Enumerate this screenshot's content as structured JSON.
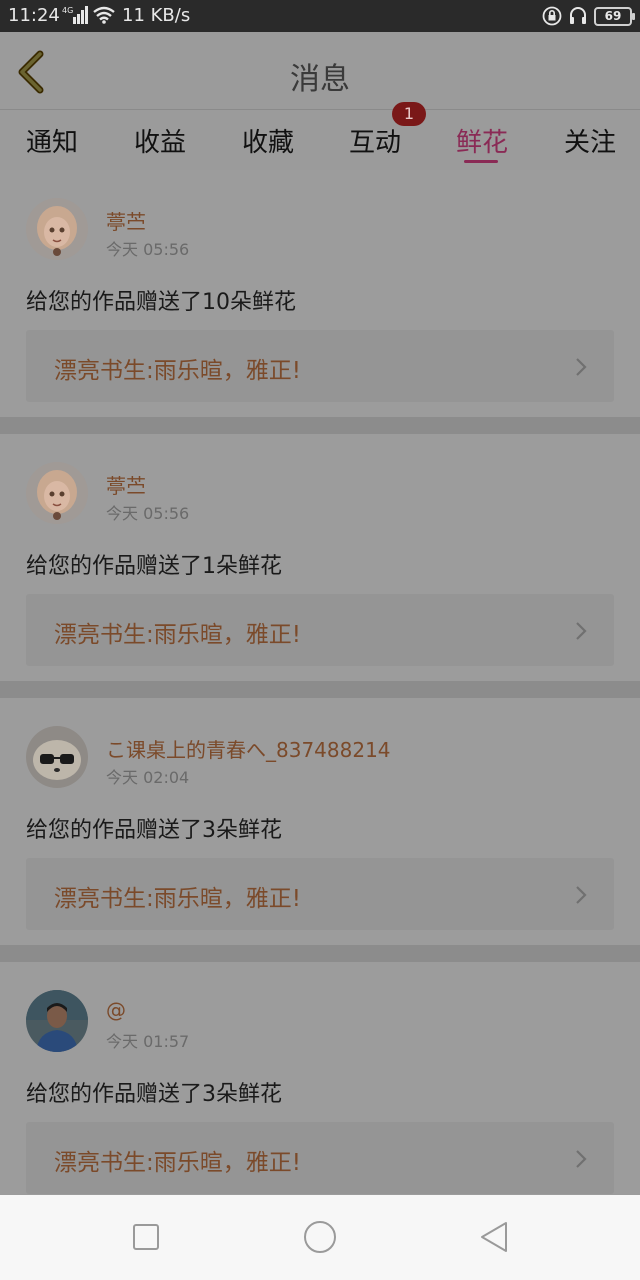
{
  "status_bar": {
    "time": "11:24",
    "speed": "11 KB/s",
    "battery": "69",
    "network": "4G"
  },
  "header": {
    "title": "消息",
    "back_icon": "chevron-left-icon"
  },
  "tabs": [
    {
      "label": "通知"
    },
    {
      "label": "收益"
    },
    {
      "label": "收藏"
    },
    {
      "label": "互动",
      "badge": "1"
    },
    {
      "label": "鲜花",
      "active": true
    },
    {
      "label": "关注"
    }
  ],
  "messages": [
    {
      "user": "葶苎",
      "time": "今天 05:56",
      "text": "给您的作品赠送了10朵鲜花",
      "work": "漂亮书生:雨乐暄，雅正!"
    },
    {
      "user": "葶苎",
      "time": "今天 05:56",
      "text": "给您的作品赠送了1朵鲜花",
      "work": "漂亮书生:雨乐暄，雅正!"
    },
    {
      "user": "こ课桌上的青春へ_837488214",
      "time": "今天 02:04",
      "text": "给您的作品赠送了3朵鲜花",
      "work": "漂亮书生:雨乐暄，雅正!"
    },
    {
      "user": "@",
      "time": "今天 01:57",
      "text": "给您的作品赠送了3朵鲜花",
      "work": "漂亮书生:雨乐暄，雅正!"
    }
  ],
  "colors": {
    "accent": "#8a2a55",
    "username": "#7b4a2a",
    "badge": "#7a1818"
  },
  "nav_bar": {
    "icons": [
      "square-icon",
      "circle-icon",
      "triangle-back-icon"
    ]
  }
}
